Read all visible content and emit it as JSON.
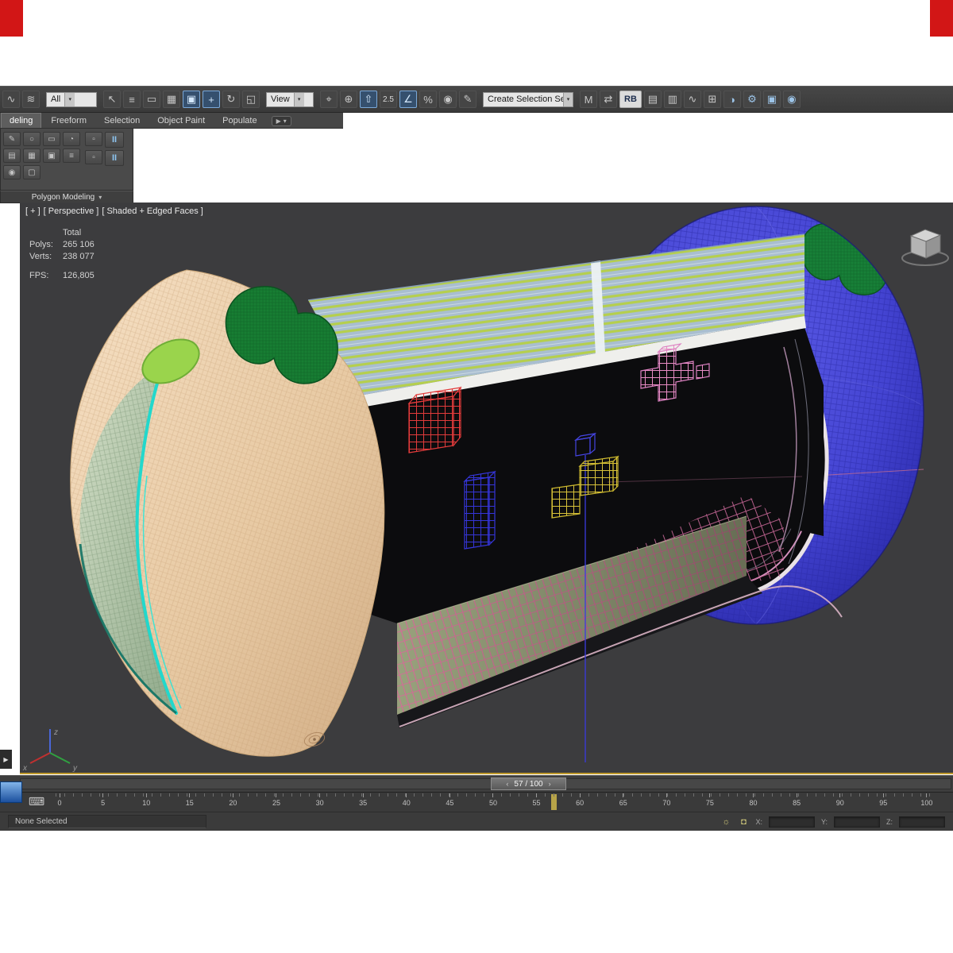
{
  "window": {
    "corner_color": "#d21616"
  },
  "toolbar": {
    "filter_dropdown": "All",
    "view_dropdown": "View",
    "selection_set_dropdown": "Create Selection Se",
    "dd_arrow": "▾",
    "group_a": [
      {
        "name": "undo-wave-icon",
        "glyph": "∿"
      },
      {
        "name": "link-ripple-icon",
        "glyph": "≋"
      }
    ],
    "group_b": [
      {
        "name": "select-object-icon",
        "glyph": "↖"
      },
      {
        "name": "select-by-name-icon",
        "glyph": "≡"
      },
      {
        "name": "rect-select-region-icon",
        "glyph": "▭"
      },
      {
        "name": "window-crossing-icon",
        "glyph": "▦"
      },
      {
        "name": "select-highlight-icon",
        "glyph": "▣",
        "cls": "active"
      },
      {
        "name": "select-and-move-icon",
        "glyph": "+",
        "cls": "active"
      },
      {
        "name": "select-and-rotate-icon",
        "glyph": "↻"
      },
      {
        "name": "select-and-scale-icon",
        "glyph": "◱"
      }
    ],
    "group_c": [
      {
        "name": "reference-coordinate-icon",
        "glyph": "⌖"
      },
      {
        "name": "use-pivot-center-icon",
        "glyph": "⊕"
      },
      {
        "name": "select-and-manipulate-icon",
        "glyph": "⇧",
        "cls": "active"
      },
      {
        "name": "snap-toggle-25-icon",
        "glyph": "2.5",
        "cls": "txt"
      },
      {
        "name": "angle-snap-icon",
        "glyph": "∠",
        "cls": "active"
      },
      {
        "name": "percent-snap-icon",
        "glyph": "%"
      },
      {
        "name": "spinner-snap-icon",
        "glyph": "◉"
      },
      {
        "name": "edit-named-selections-icon",
        "glyph": "✎"
      }
    ],
    "group_d": [
      {
        "name": "mirror-icon",
        "glyph": "M"
      },
      {
        "name": "align-icon",
        "glyph": "⇄"
      },
      {
        "name": "rb-chip",
        "glyph": "RB",
        "cls": "chip"
      },
      {
        "name": "layer-manager-icon",
        "glyph": "▤"
      },
      {
        "name": "ribbon-toggle-icon",
        "glyph": "▥"
      },
      {
        "name": "curve-editor-icon",
        "glyph": "∿"
      },
      {
        "name": "schematic-view-icon",
        "glyph": "⊞"
      },
      {
        "name": "material-editor-icon",
        "glyph": "◑",
        "cls": "blue"
      },
      {
        "name": "render-setup-icon",
        "glyph": "⚙",
        "cls": "blue"
      },
      {
        "name": "rendered-frame-icon",
        "glyph": "▣",
        "cls": "blue"
      },
      {
        "name": "render-production-icon",
        "glyph": "◉",
        "cls": "blue"
      }
    ]
  },
  "ribbon": {
    "tabs": [
      {
        "name": "tab-modeling",
        "label": "deling",
        "cls": "active"
      },
      {
        "name": "tab-freeform",
        "label": "Freeform"
      },
      {
        "name": "tab-selection",
        "label": "Selection"
      },
      {
        "name": "tab-object-paint",
        "label": "Object Paint"
      },
      {
        "name": "tab-populate",
        "label": "Populate"
      }
    ],
    "cam_glyph": "▶",
    "cam_caret": "▾",
    "panel_title": "Polygon Modeling",
    "panel_caret": "▾",
    "panel_icons_row1": [
      {
        "name": "pm-pencil-icon",
        "glyph": "✎"
      },
      {
        "name": "pm-circle-icon",
        "glyph": "○"
      },
      {
        "name": "pm-rect-icon",
        "glyph": "▭"
      },
      {
        "name": "pm-sphere-icon",
        "glyph": "◔"
      }
    ],
    "panel_icons_row2": [
      {
        "name": "pm-grid-icon",
        "glyph": "▤"
      },
      {
        "name": "pm-mesh-icon",
        "glyph": "▦"
      },
      {
        "name": "pm-solid-icon",
        "glyph": "▣"
      },
      {
        "name": "pm-lines-icon",
        "glyph": "≡"
      }
    ],
    "panel_icons_row3": [
      {
        "name": "pm-dot-icon",
        "glyph": "◉"
      },
      {
        "name": "pm-box-icon",
        "glyph": "▢"
      }
    ],
    "panel_side": [
      {
        "name": "pm-mini-1-icon",
        "glyph": "▫"
      },
      {
        "name": "pm-pinned-panel-icon",
        "glyph": "II",
        "cls": "bright"
      },
      {
        "name": "pm-mini-2-icon",
        "glyph": "▫"
      },
      {
        "name": "pm-pinned-panel-2-icon",
        "glyph": "II",
        "cls": "bright"
      }
    ]
  },
  "viewport": {
    "label_plus": "[ + ]",
    "label_view": "[ Perspective ]",
    "label_shading": "[ Shaded + Edged Faces ]",
    "stats": {
      "header": "Total",
      "polys_label": "Polys:",
      "polys": "265 106",
      "verts_label": "Verts:",
      "verts": "238 077",
      "fps_label": "FPS:",
      "fps": "126,805"
    },
    "axis": {
      "x": "x",
      "y": "y",
      "z": "z"
    }
  },
  "timeline": {
    "slider_value": "57 / 100",
    "prev": "‹",
    "next": "›",
    "ticks": [
      "0",
      "5",
      "10",
      "15",
      "20",
      "25",
      "30",
      "35",
      "40",
      "45",
      "50",
      "55",
      "60",
      "65",
      "70",
      "75",
      "80",
      "85",
      "90",
      "95",
      "100"
    ],
    "current_frame": 57
  },
  "status_bar": {
    "selection_status": "None Selected",
    "x_label": "X:",
    "y_label": "Y:",
    "z_label": "Z:"
  },
  "chrome": {
    "expand_arrow": "▶",
    "kbd_glyph": "⌨"
  },
  "scene": {
    "object": "sci-fi capsule pod, shaded + edged faces",
    "colors": {
      "viewport_bg": "#3c3c3e",
      "egg_shell": "#ecd2b0",
      "egg_blob_green": "#177e33",
      "lime_oval": "#9ad44c",
      "teal_rim": "#22d8cc",
      "roof": "#a9bed0",
      "roof_stripe": "#b5cf4d",
      "floor": "#98a17c",
      "floor_grid": "#d9679a",
      "sphere_blue": "#4444d2",
      "wire_red": "#e23b3b",
      "wire_blue": "#3535d8",
      "wire_yellow": "#d8c23a",
      "wire_pink": "#e88cc4"
    }
  }
}
